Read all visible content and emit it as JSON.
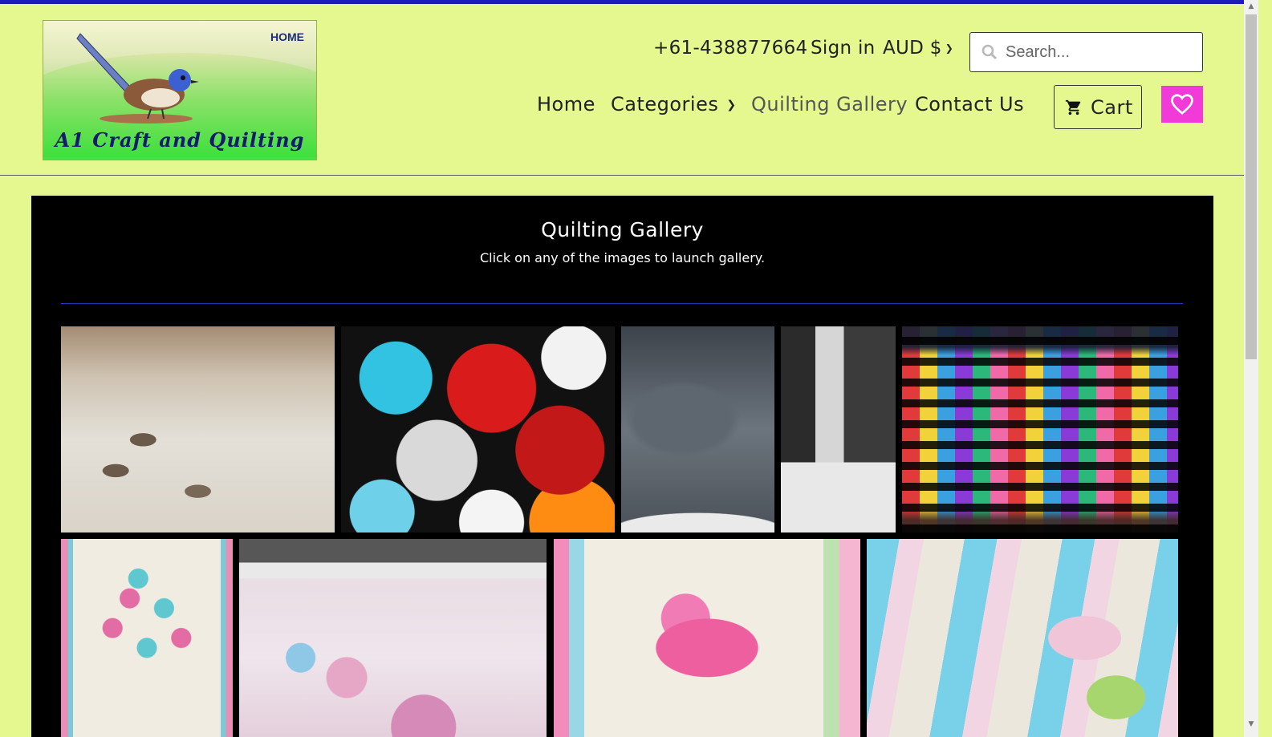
{
  "logo": {
    "home_label": "HOME",
    "brand_name": "A1 Craft and Quilting"
  },
  "header": {
    "phone": "+61-438877664",
    "sign_in": "Sign in",
    "currency": "AUD $",
    "search_placeholder": "Search..."
  },
  "nav": {
    "home": "Home",
    "categories": "Categories",
    "quilting_gallery": "Quilting Gallery",
    "contact_us": "Contact Us"
  },
  "cart": {
    "label": "Cart"
  },
  "gallery": {
    "title": "Quilting Gallery",
    "subtitle": "Click on any of the images to launch gallery."
  },
  "colors": {
    "page_background": "#e4f88f",
    "top_bar": "#1d1db5",
    "wishlist_button": "#f23ad9",
    "gallery_background": "#000000"
  },
  "icons": [
    "search-icon",
    "chevron-down-icon",
    "cart-icon",
    "heart-icon"
  ]
}
